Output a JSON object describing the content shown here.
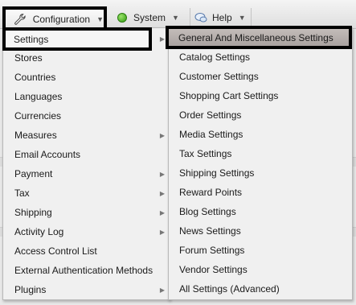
{
  "menubar": {
    "configuration_label": "Configuration",
    "system_label": "System",
    "help_label": "Help",
    "caret": "▼"
  },
  "main_menu": [
    {
      "label": "Settings",
      "submenu": true
    },
    {
      "label": "Stores",
      "submenu": false
    },
    {
      "label": "Countries",
      "submenu": false
    },
    {
      "label": "Languages",
      "submenu": false
    },
    {
      "label": "Currencies",
      "submenu": false
    },
    {
      "label": "Measures",
      "submenu": true
    },
    {
      "label": "Email Accounts",
      "submenu": false
    },
    {
      "label": "Payment",
      "submenu": true
    },
    {
      "label": "Tax",
      "submenu": true
    },
    {
      "label": "Shipping",
      "submenu": true
    },
    {
      "label": "Activity Log",
      "submenu": true
    },
    {
      "label": "Access Control List",
      "submenu": false
    },
    {
      "label": "External Authentication Methods",
      "submenu": false
    },
    {
      "label": "Plugins",
      "submenu": true
    }
  ],
  "submenu_arrow": "▶",
  "settings_submenu": [
    "General And Miscellaneous Settings",
    "Catalog Settings",
    "Customer Settings",
    "Shopping Cart Settings",
    "Order Settings",
    "Media Settings",
    "Tax Settings",
    "Shipping Settings",
    "Reward Points",
    "Blog Settings",
    "News Settings",
    "Forum Settings",
    "Vendor Settings",
    "All Settings (Advanced)"
  ],
  "colors": {
    "highlight_border": "#000000",
    "active_item_bg": "#b5aeab",
    "menu_bg": "#f0f0f0"
  }
}
